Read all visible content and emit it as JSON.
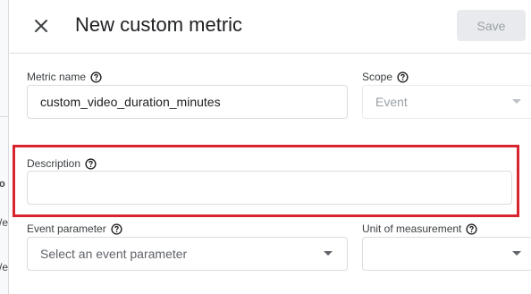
{
  "background": {
    "fragments": [
      "o",
      "/e",
      "/e"
    ]
  },
  "dialog": {
    "title": "New custom metric",
    "save_label": "Save"
  },
  "form": {
    "metric_name": {
      "label": "Metric name",
      "value": "custom_video_duration_minutes"
    },
    "scope": {
      "label": "Scope",
      "value": "Event"
    },
    "description": {
      "label": "Description",
      "value": ""
    },
    "event_parameter": {
      "label": "Event parameter",
      "placeholder": "Select an event parameter"
    },
    "unit_of_measurement": {
      "label": "Unit of measurement",
      "value": ""
    }
  },
  "colors": {
    "highlight": "#d9232e",
    "disabled_button_bg": "#e8eaed"
  }
}
